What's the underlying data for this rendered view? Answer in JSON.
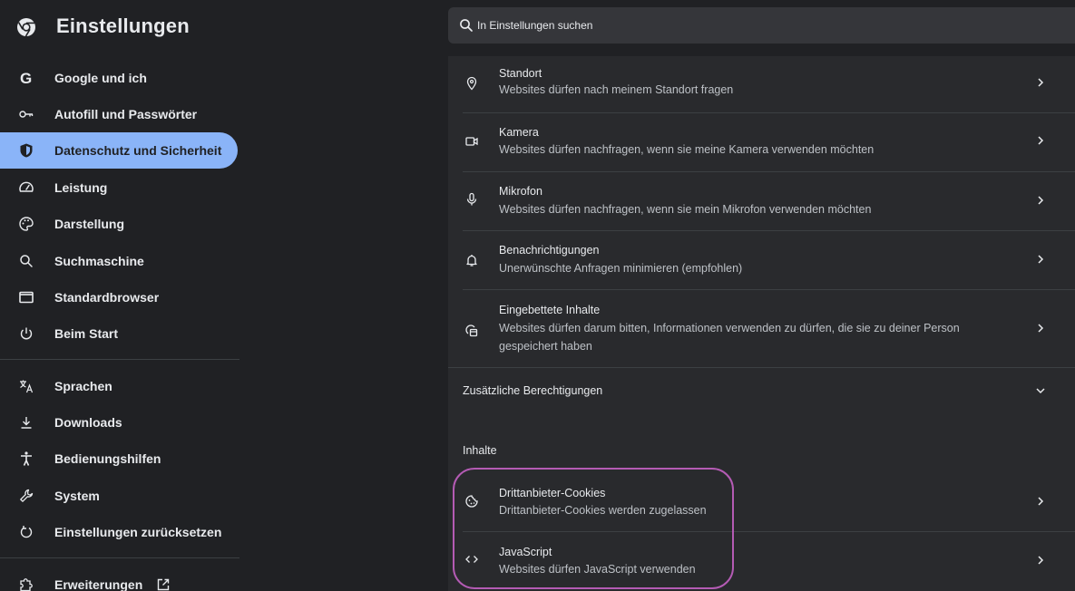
{
  "header": {
    "title": "Einstellungen",
    "search_placeholder": "In Einstellungen suchen"
  },
  "sidebar": {
    "items": [
      {
        "label": "Google und ich",
        "icon": "google-g-icon"
      },
      {
        "label": "Autofill und Passwörter",
        "icon": "key-icon"
      },
      {
        "label": "Datenschutz und Sicherheit",
        "icon": "shield-icon",
        "active": true
      },
      {
        "label": "Leistung",
        "icon": "speedometer-icon"
      },
      {
        "label": "Darstellung",
        "icon": "palette-icon"
      },
      {
        "label": "Suchmaschine",
        "icon": "search-icon"
      },
      {
        "label": "Standardbrowser",
        "icon": "browser-window-icon"
      },
      {
        "label": "Beim Start",
        "icon": "power-icon"
      },
      {
        "label": "Sprachen",
        "icon": "translate-icon"
      },
      {
        "label": "Downloads",
        "icon": "download-icon"
      },
      {
        "label": "Bedienungshilfen",
        "icon": "accessibility-icon"
      },
      {
        "label": "System",
        "icon": "wrench-icon"
      },
      {
        "label": "Einstellungen zurücksetzen",
        "icon": "reset-icon"
      },
      {
        "label": "Erweiterungen",
        "icon": "puzzle-icon"
      }
    ]
  },
  "main": {
    "permissions": [
      {
        "title": "Standort",
        "subtitle": "Websites dürfen nach meinem Standort fragen",
        "icon": "location-pin-icon"
      },
      {
        "title": "Kamera",
        "subtitle": "Websites dürfen nachfragen, wenn sie meine Kamera verwenden möchten",
        "icon": "camera-icon"
      },
      {
        "title": "Mikrofon",
        "subtitle": "Websites dürfen nachfragen, wenn sie mein Mikrofon verwenden möchten",
        "icon": "microphone-icon"
      },
      {
        "title": "Benachrichtigungen",
        "subtitle": "Unerwünschte Anfragen minimieren (empfohlen)",
        "icon": "bell-icon"
      },
      {
        "title": "Eingebettete Inhalte",
        "subtitle": "Websites dürfen darum bitten, Informationen verwenden zu dürfen, die sie zu deiner Person gespeichert haben",
        "icon": "embedded-content-icon"
      }
    ],
    "additional_permissions_label": "Zusätzliche Berechtigungen",
    "content_section_label": "Inhalte",
    "content": [
      {
        "title": "Drittanbieter-Cookies",
        "subtitle": "Drittanbieter-Cookies werden zugelassen",
        "icon": "cookie-icon"
      },
      {
        "title": "JavaScript",
        "subtitle": "Websites dürfen JavaScript verwenden",
        "icon": "code-brackets-icon"
      }
    ]
  },
  "colors": {
    "background": "#202124",
    "panel": "#292a2d",
    "active_nav": "#8ab4f8",
    "highlight": "#b45bb4"
  }
}
